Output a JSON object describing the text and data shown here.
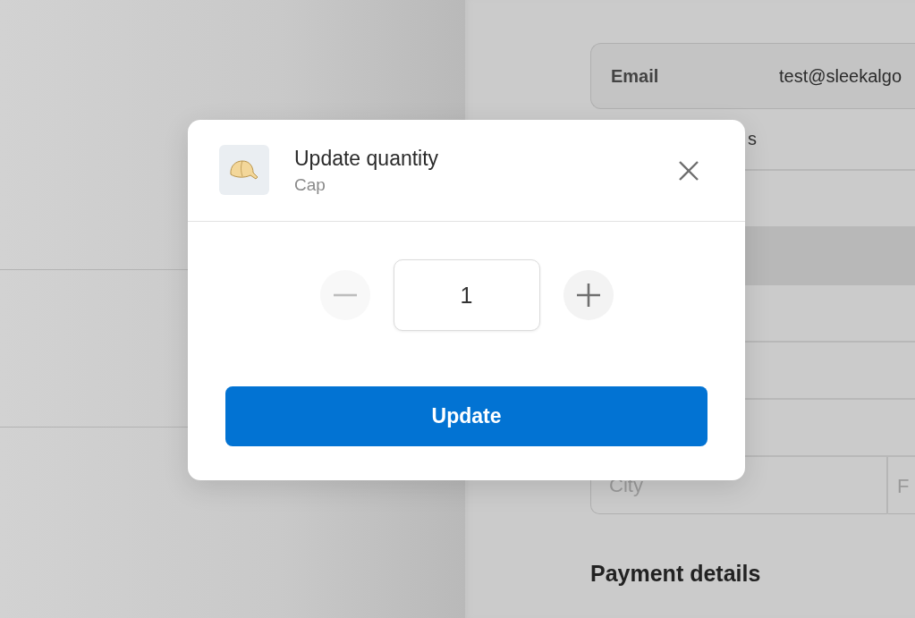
{
  "background": {
    "email": {
      "label": "Email",
      "value": "test@sleekalgo"
    },
    "label_fragment": "s",
    "city": {
      "placeholder": "City"
    },
    "field_fragment": "F",
    "payment_heading": "Payment details"
  },
  "dialog": {
    "title": "Update quantity",
    "subtitle": "Cap",
    "quantity": "1",
    "decrement_disabled": true,
    "button": "Update"
  }
}
